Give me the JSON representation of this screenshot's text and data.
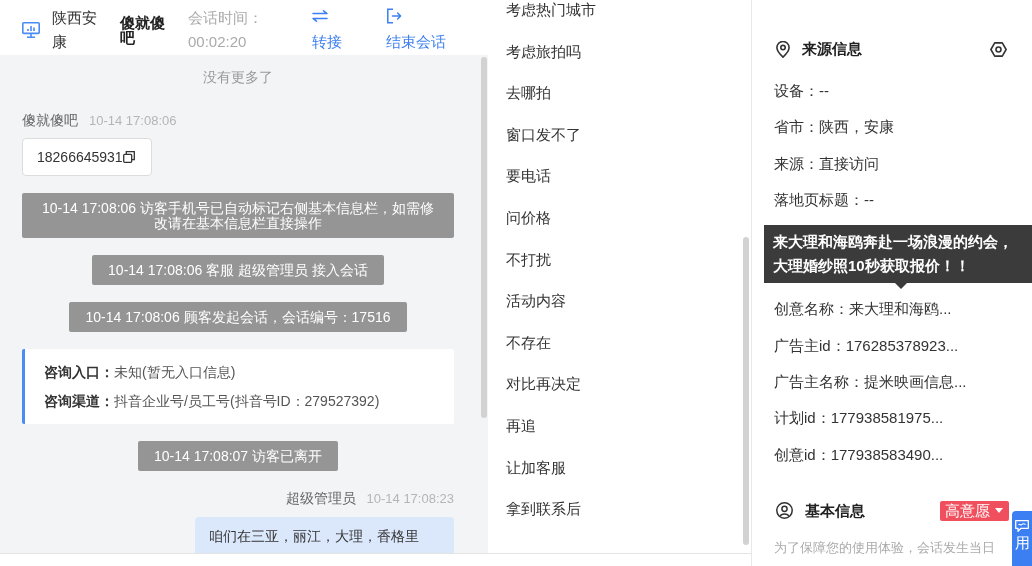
{
  "chat_header": {
    "location": "陕西安康",
    "visitor_name": "傻就傻吧",
    "session_time_label": "会话时间：",
    "session_time": "00:02:20",
    "actions": [
      {
        "kind": "transfer",
        "label": "转接"
      },
      {
        "kind": "end_session",
        "label": "结束会话"
      }
    ]
  },
  "chat": {
    "messages": [
      {
        "kind": "end_marker",
        "text": "没有更多了"
      },
      {
        "kind": "visitor",
        "sender": "傻就傻吧",
        "time": "10-14 17:08:06",
        "text": "18266645931",
        "copyable": true
      },
      {
        "kind": "notice",
        "text": "10-14 17:08:06 访客手机号已自动标记右侧基本信息栏，如需修改请在基本信息栏直接操作"
      },
      {
        "kind": "notice",
        "text": "10-14 17:08:06 客服 超级管理员 接入会话"
      },
      {
        "kind": "notice",
        "text": "10-14 17:08:06 顾客发起会话，会话编号：17516"
      },
      {
        "kind": "info_card",
        "rows": [
          {
            "label": "咨询入口：",
            "value": "未知(暂无入口信息)"
          },
          {
            "label": "咨询渠道：",
            "value": "抖音企业号/员工号(抖音号ID：279527392)"
          }
        ]
      },
      {
        "kind": "notice",
        "text": "10-14 17:08:07 访客已离开"
      },
      {
        "kind": "agent",
        "sender": "超级管理员",
        "time": "10-14 17:08:23",
        "text": "咱们在三亚，丽江，大理，香格里"
      }
    ]
  },
  "quick_replies": [
    "考虑热门城市",
    "考虑旅拍吗",
    "去哪拍",
    "窗口发不了",
    "要电话",
    "问价格",
    "不打扰",
    "活动内容",
    "不存在",
    "对比再决定",
    "再追",
    "让加客服",
    "拿到联系后"
  ],
  "source_info": {
    "title": "来源信息",
    "fields": [
      {
        "text": "设备：--"
      },
      {
        "text": "省市：陕西，安康"
      },
      {
        "text": "来源：直接访问"
      },
      {
        "text": "落地页标题：--"
      },
      {
        "text": "创意名称：来大理和海鸥...",
        "tooltip": "来大理和海鸥奔赴一场浪漫的约会，大理婚纱照10秒获取报价！！"
      },
      {
        "text": "广告主id：176285378923..."
      },
      {
        "text": "广告主名称：提米映画信息..."
      },
      {
        "text": "计划id：177938581975..."
      },
      {
        "text": "创意id：177938583490..."
      }
    ]
  },
  "basic_info": {
    "title": "基本信息",
    "intent_tag": "高意愿",
    "notice": "为了保障您的使用体验，会话发生当日"
  },
  "floating_button": {
    "label": "用"
  }
}
